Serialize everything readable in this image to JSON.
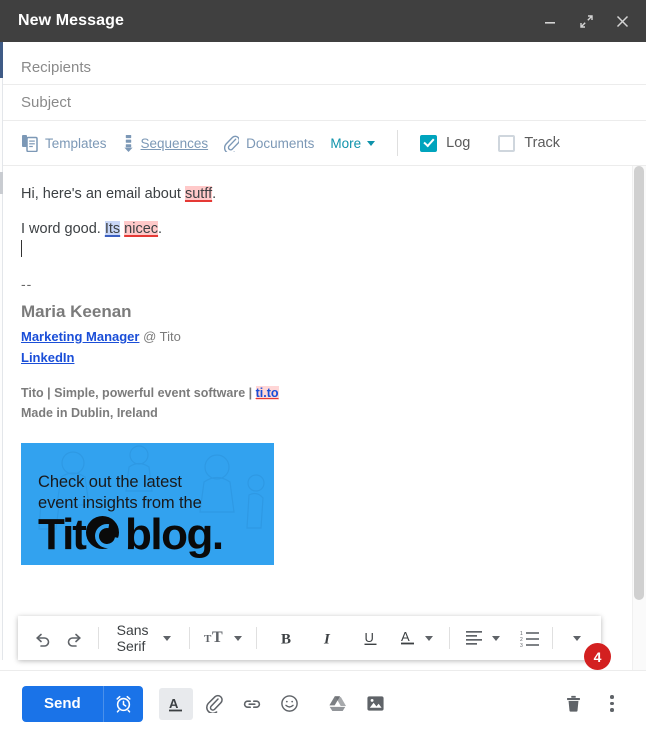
{
  "window": {
    "title": "New Message",
    "header_bg": "#404040",
    "controls": [
      {
        "name": "minimize",
        "label": "Minimize"
      },
      {
        "name": "expand",
        "label": "Full screen"
      },
      {
        "name": "close",
        "label": "Close"
      }
    ]
  },
  "fields": {
    "recipients_placeholder": "Recipients",
    "recipients_value": "",
    "subject_placeholder": "Subject",
    "subject_value": ""
  },
  "sales_toolbar": {
    "templates_label": "Templates",
    "sequences_label": "Sequences",
    "documents_label": "Documents",
    "more_label": "More",
    "log_label": "Log",
    "track_label": "Track",
    "log_checked": true,
    "track_checked": false,
    "muted_color": "#7c98b6",
    "accent_color": "#00a4bd"
  },
  "body": {
    "line1_a": "Hi, here's an email about ",
    "line1_err": "sutff",
    "line1_b": ".",
    "line2_a": "I word good. ",
    "line2_grammar": "Its",
    "line2_mid": " ",
    "line2_err": "nicec",
    "line2_b": ".",
    "spell_error_bg": "#ffc9c9",
    "grammar_error_bg": "#c9d7f7"
  },
  "signature": {
    "dashes": "--",
    "name": "Maria Keenan",
    "role_link": "Marketing Manager",
    "role_suffix": " @ Tito",
    "linkedin": "LinkedIn",
    "tagline_a": "Tito | Simple, powerful event software | ",
    "tagline_link": "ti.to",
    "made_in": "Made in Dublin, Ireland",
    "link_color": "#1a4ed8"
  },
  "banner": {
    "line1": "Check out the latest",
    "line2": "event insights from the",
    "logo_prefix": "Tit",
    "logo_suffix": "blog.",
    "bg_color": "#32a2ef"
  },
  "format_toolbar": {
    "undo_label": "Undo",
    "redo_label": "Redo",
    "font_family": "Sans Serif",
    "font_size_label": "Size",
    "bold_label": "Bold",
    "italic_label": "Italic",
    "underline_label": "Underline",
    "text_color_label": "Text color",
    "align_label": "Align",
    "numbered_list_label": "Numbered list",
    "more_label": "More formatting options",
    "badge_count": "4",
    "badge_color": "#d32020"
  },
  "bottom_bar": {
    "send_label": "Send",
    "schedule_label": "Schedule send",
    "formatting_label": "Formatting options",
    "attach_label": "Attach files",
    "link_label": "Insert link",
    "emoji_label": "Insert emoji",
    "drive_label": "Insert files using Drive",
    "photo_label": "Insert photo",
    "discard_label": "Discard draft",
    "more_options_label": "More options",
    "send_color": "#1a73e8"
  }
}
